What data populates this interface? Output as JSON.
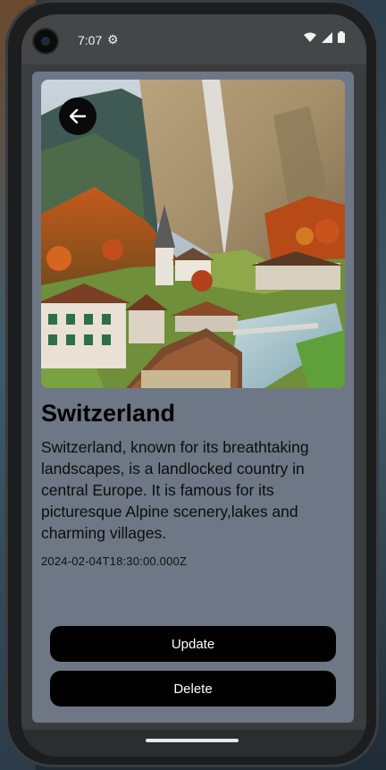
{
  "status_bar": {
    "time": "7:07",
    "settings_glyph": "gear-icon",
    "icons": [
      "wifi-icon",
      "signal-icon",
      "battery-icon"
    ]
  },
  "place": {
    "name": "Switzerland",
    "description": "Switzerland, known for its breathtaking landscapes, is a landlocked country in central Europe. It is famous for its picturesque Alpine scenery,lakes and charming villages.",
    "date": "2024-02-04T18:30:00.000Z"
  },
  "actions": {
    "update_label": "Update",
    "delete_label": "Delete"
  },
  "colors": {
    "card_background": "#6e7785",
    "button_background": "#000000",
    "button_text": "#ffffff"
  }
}
